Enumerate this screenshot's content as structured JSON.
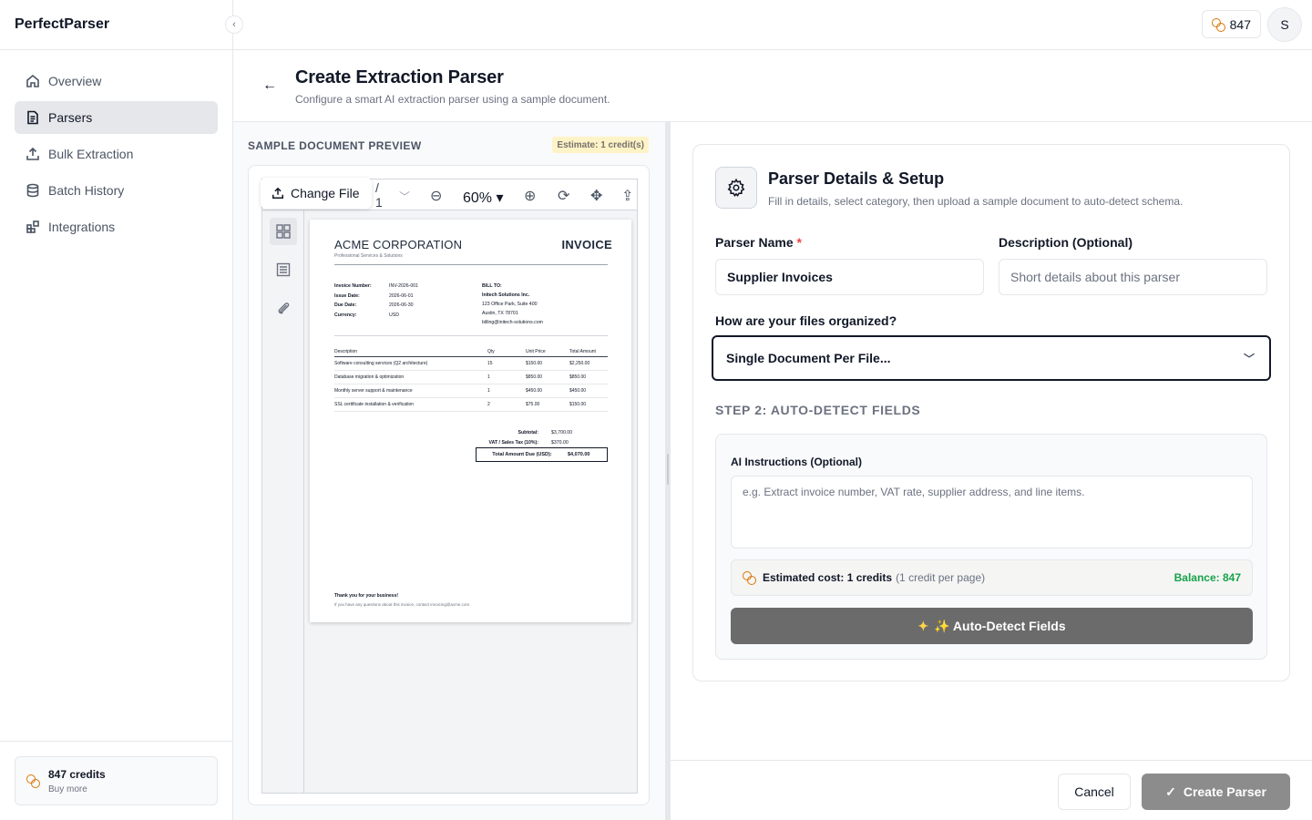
{
  "app": {
    "name": "PerfectParser"
  },
  "sidebar": {
    "items": [
      {
        "label": "Overview",
        "icon": "home-icon"
      },
      {
        "label": "Parsers",
        "icon": "document-icon",
        "active": true
      },
      {
        "label": "Bulk Extraction",
        "icon": "upload-icon"
      },
      {
        "label": "Batch History",
        "icon": "database-icon"
      },
      {
        "label": "Integrations",
        "icon": "integrations-icon"
      }
    ],
    "credits": {
      "title": "847 credits",
      "sub": "Buy more"
    }
  },
  "topbar": {
    "credits": "847",
    "avatar_initial": "S"
  },
  "page": {
    "title": "Create Extraction Parser",
    "subtitle": "Configure a smart AI extraction parser using a sample document."
  },
  "preview": {
    "section_label": "SAMPLE DOCUMENT PREVIEW",
    "estimate": "Estimate: 1 credit(s)",
    "change_file": "Change File",
    "page_indicator": "/\n1",
    "zoom": "60% ▾",
    "invoice": {
      "company": "ACME CORPORATION",
      "tagline": "Professional Services & Solutions",
      "title": "INVOICE",
      "meta": [
        {
          "k": "Invoice Number:",
          "v": "INV-2026-001"
        },
        {
          "k": "Issue Date:",
          "v": "2026-06-01"
        },
        {
          "k": "Due Date:",
          "v": "2026-06-30"
        },
        {
          "k": "Currency:",
          "v": "USD"
        }
      ],
      "bill_to_label": "BILL TO:",
      "bill_to_name": "Initech Solutions Inc.",
      "bill_to_lines": [
        "123 Office Park, Suite 400",
        "Austin, TX 78701",
        "billing@initech-solutions.com"
      ],
      "table_head": [
        "Description",
        "Qty",
        "Unit Price",
        "Total Amount"
      ],
      "rows": [
        [
          "Software consulting services (Q2 architecture)",
          "15",
          "$150.00",
          "$2,250.00"
        ],
        [
          "Database migration & optimization",
          "1",
          "$850.00",
          "$850.00"
        ],
        [
          "Monthly server support & maintenance",
          "1",
          "$450.00",
          "$450.00"
        ],
        [
          "SSL certificate installation & verification",
          "2",
          "$75.00",
          "$150.00"
        ]
      ],
      "subtotal_label": "Subtotal:",
      "subtotal": "$3,700.00",
      "tax_label": "VAT / Sales Tax (10%):",
      "tax": "$370.00",
      "total_label": "Total Amount Due (USD):",
      "total": "$4,070.00",
      "thanks": "Thank you for your business!",
      "note": "If you have any questions about this invoice, contact invoicing@acme.com"
    }
  },
  "form": {
    "title": "Parser Details & Setup",
    "subtitle": "Fill in details, select category, then upload a sample document to auto-detect schema.",
    "parser_name_label": "Parser Name",
    "parser_name_required": "*",
    "parser_name_value": "Supplier Invoices",
    "description_label": "Description (Optional)",
    "description_placeholder": "Short details about this parser",
    "organized_label": "How are your files organized?",
    "organized_value": "Single Document Per File...",
    "step2_label": "STEP 2: AUTO-DETECT FIELDS",
    "ai_label": "AI Instructions (Optional)",
    "ai_placeholder": "e.g. Extract invoice number, VAT rate, supplier address, and line items.",
    "cost_strong": "Estimated cost: 1 credits",
    "cost_muted": "(1 credit per page)",
    "balance": "Balance: 847",
    "detect_button": "✨ Auto-Detect Fields"
  },
  "footer": {
    "cancel": "Cancel",
    "create": "Create Parser"
  },
  "colors": {
    "accent": "#111827",
    "balance": "#16a34a",
    "coin": "#d97706",
    "required": "#ef4444"
  }
}
